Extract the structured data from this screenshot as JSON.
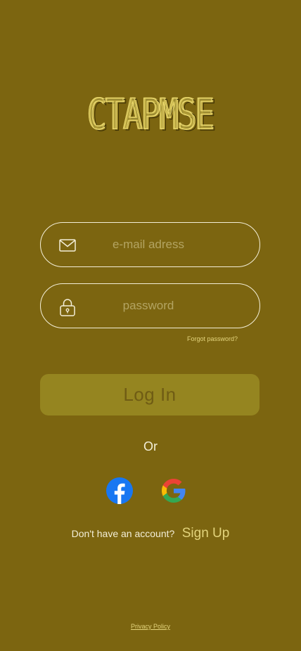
{
  "logo": {
    "text": "CTAPMSE"
  },
  "email": {
    "placeholder": "e-mail adress",
    "icon": "mail-icon"
  },
  "password": {
    "placeholder": "password",
    "icon": "lock-icon"
  },
  "forgot_label": "Forgot password?",
  "login_label": "Log In",
  "divider_label": "Or",
  "social": [
    {
      "provider": "Facebook",
      "icon": "facebook-icon"
    },
    {
      "provider": "Google",
      "icon": "google-icon"
    }
  ],
  "signup": {
    "prompt": "Don't have an account?",
    "link_label": "Sign Up"
  },
  "privacy_label": "Privacy Policy",
  "colors": {
    "background": "#7c6510",
    "accent": "#e3d47c",
    "button": "#958520",
    "text": "#f3eed7"
  }
}
